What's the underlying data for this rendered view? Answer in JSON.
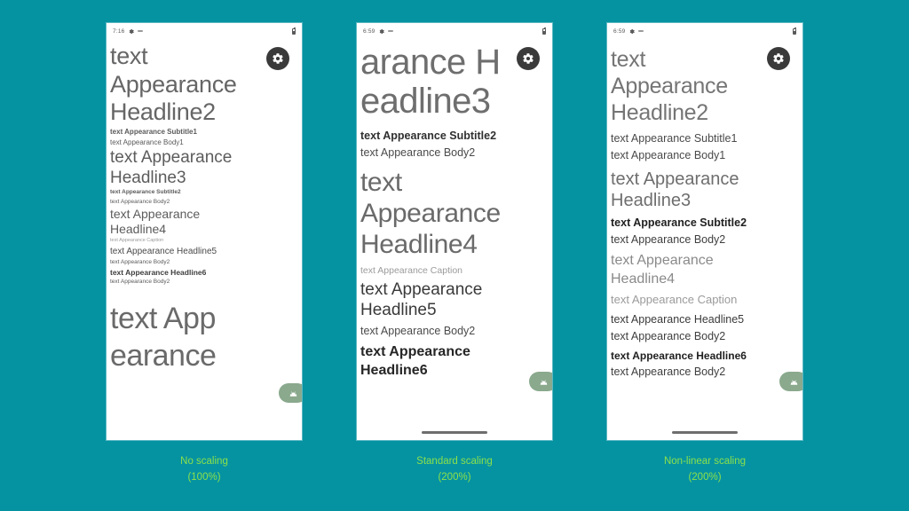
{
  "background_color": "#0593a2",
  "caption_color": "#8ce04a",
  "panels": [
    {
      "caption_title": "No scaling",
      "caption_percent": "(100%)",
      "status": {
        "time": "7:16",
        "gear_icon": "gear-icon",
        "dash_icon": "dash-icon",
        "battery_icon": "battery-icon"
      },
      "fab_settings_icon": "gear-icon",
      "fab_android_icon": "android-icon",
      "lines": [
        {
          "style": "h2",
          "text": "text"
        },
        {
          "style": "h2",
          "text": "Appearance"
        },
        {
          "style": "h2",
          "text": "Headline2"
        },
        {
          "style": "sub1",
          "text": "text Appearance Subtitle1"
        },
        {
          "style": "body1",
          "text": "text Appearance Body1"
        },
        {
          "style": "h3",
          "text": "text Appearance"
        },
        {
          "style": "h3",
          "text": "Headline3"
        },
        {
          "style": "sub2",
          "text": "text Appearance Subtitle2"
        },
        {
          "style": "body2",
          "text": "text Appearance Body2"
        },
        {
          "style": "h4",
          "text": "text Appearance"
        },
        {
          "style": "h4",
          "text": "Headline4"
        },
        {
          "style": "cap",
          "text": "text Appearance Caption"
        },
        {
          "style": "h5",
          "text": "text Appearance Headline5"
        },
        {
          "style": "body2",
          "text": "text Appearance Body2"
        },
        {
          "style": "h6",
          "text": "text Appearance Headline6"
        },
        {
          "style": "body2",
          "text": "text Appearance Body2"
        },
        {
          "style": "big",
          "text": "text App"
        },
        {
          "style": "big",
          "text": "earance"
        }
      ]
    },
    {
      "caption_title": "Standard scaling",
      "caption_percent": "(200%)",
      "status": {
        "time": "6:59",
        "gear_icon": "gear-icon",
        "dash_icon": "dash-icon",
        "battery_icon": "battery-icon"
      },
      "fab_settings_icon": "gear-icon",
      "fab_android_icon": "android-icon",
      "lines": [
        {
          "style": "h3",
          "text": "arance H"
        },
        {
          "style": "h3",
          "text": "eadline3"
        },
        {
          "style": "sub2",
          "text": "text Appearance Subtitle2"
        },
        {
          "style": "body2",
          "text": "text Appearance Body2"
        },
        {
          "style": "h4",
          "text": "text"
        },
        {
          "style": "h4",
          "text": "Appearance"
        },
        {
          "style": "h4",
          "text": "Headline4"
        },
        {
          "style": "cap",
          "text": "text Appearance Caption"
        },
        {
          "style": "h5",
          "text": "text Appearance"
        },
        {
          "style": "h5",
          "text": "Headline5"
        },
        {
          "style": "body2",
          "text": "text Appearance Body2"
        },
        {
          "style": "h6",
          "text": "text Appearance"
        },
        {
          "style": "h6",
          "text": "Headline6"
        }
      ]
    },
    {
      "caption_title": "Non-linear scaling",
      "caption_percent": "(200%)",
      "status": {
        "time": "6:59",
        "gear_icon": "gear-icon",
        "dash_icon": "dash-icon",
        "battery_icon": "battery-icon"
      },
      "fab_settings_icon": "gear-icon",
      "fab_android_icon": "android-icon",
      "lines": [
        {
          "style": "h2",
          "text": "text"
        },
        {
          "style": "h2",
          "text": "Appearance"
        },
        {
          "style": "h2",
          "text": "Headline2"
        },
        {
          "style": "sub1",
          "text": "text Appearance Subtitle1"
        },
        {
          "style": "body1",
          "text": "text Appearance Body1"
        },
        {
          "style": "h3",
          "text": "text Appearance"
        },
        {
          "style": "h3",
          "text": "Headline3"
        },
        {
          "style": "sub2",
          "text": "text Appearance Subtitle2"
        },
        {
          "style": "body2",
          "text": "text Appearance Body2"
        },
        {
          "style": "h4",
          "text": "text Appearance"
        },
        {
          "style": "h4",
          "text": "Headline4"
        },
        {
          "style": "cap",
          "text": "text Appearance Caption"
        },
        {
          "style": "h5",
          "text": "text Appearance Headline5"
        },
        {
          "style": "body2",
          "text": "text Appearance Body2"
        },
        {
          "style": "h6",
          "text": "text Appearance Headline6"
        },
        {
          "style": "body2",
          "text": "text Appearance Body2"
        }
      ]
    }
  ]
}
